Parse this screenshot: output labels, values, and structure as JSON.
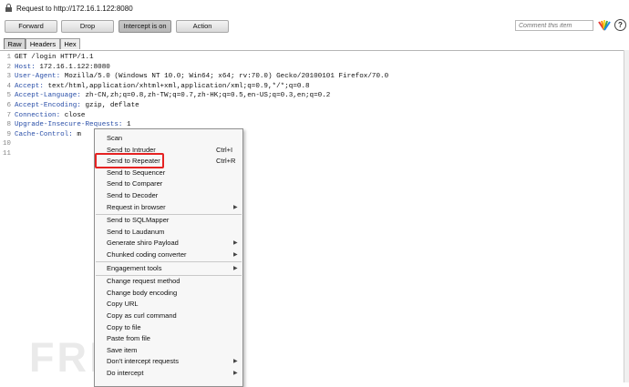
{
  "request_title": "Request to http://172.16.1.122:8080",
  "toolbar": {
    "forward": "Forward",
    "drop": "Drop",
    "intercept": "Intercept is on",
    "action": "Action",
    "comment_placeholder": "Comment this item"
  },
  "tabs": [
    "Raw",
    "Headers",
    "Hex"
  ],
  "lines": [
    {
      "n": "1",
      "k": "",
      "v": "GET /login HTTP/1.1"
    },
    {
      "n": "2",
      "k": "Host:",
      "v": " 172.16.1.122:8080"
    },
    {
      "n": "3",
      "k": "User-Agent:",
      "v": " Mozilla/5.0 (Windows NT 10.0; Win64; x64; rv:70.0) Gecko/20100101 Firefox/70.0"
    },
    {
      "n": "4",
      "k": "Accept:",
      "v": " text/html,application/xhtml+xml,application/xml;q=0.9,*/*;q=0.8"
    },
    {
      "n": "5",
      "k": "Accept-Language:",
      "v": " zh-CN,zh;q=0.8,zh-TW;q=0.7,zh-HK;q=0.5,en-US;q=0.3,en;q=0.2"
    },
    {
      "n": "6",
      "k": "Accept-Encoding:",
      "v": " gzip, deflate"
    },
    {
      "n": "7",
      "k": "Connection:",
      "v": " close"
    },
    {
      "n": "8",
      "k": "Upgrade-Insecure-Requests:",
      "v": " 1"
    },
    {
      "n": "9",
      "k": "Cache-Control:",
      "v": " m"
    },
    {
      "n": "10",
      "k": "",
      "v": ""
    },
    {
      "n": "11",
      "k": "",
      "v": ""
    }
  ],
  "context_menu": {
    "items": [
      {
        "label": "Scan",
        "shortcut": "",
        "submenu": false
      },
      {
        "label": "Send to Intruder",
        "shortcut": "Ctrl+I",
        "submenu": false
      },
      {
        "label": "Send to Repeater",
        "shortcut": "Ctrl+R",
        "submenu": false
      },
      {
        "label": "Send to Sequencer",
        "shortcut": "",
        "submenu": false
      },
      {
        "label": "Send to Comparer",
        "shortcut": "",
        "submenu": false
      },
      {
        "label": "Send to Decoder",
        "shortcut": "",
        "submenu": false
      },
      {
        "label": "Request in browser",
        "shortcut": "",
        "submenu": true
      },
      {
        "label": "Send to SQLMapper",
        "shortcut": "",
        "submenu": false
      },
      {
        "label": "Send to Laudanum",
        "shortcut": "",
        "submenu": false
      },
      {
        "label": "Generate shiro Payload",
        "shortcut": "",
        "submenu": true
      },
      {
        "label": "Chunked coding converter",
        "shortcut": "",
        "submenu": true
      },
      {
        "label": "Engagement tools",
        "shortcut": "",
        "submenu": true
      },
      {
        "label": "Change request method",
        "shortcut": "",
        "submenu": false
      },
      {
        "label": "Change body encoding",
        "shortcut": "",
        "submenu": false
      },
      {
        "label": "Copy URL",
        "shortcut": "",
        "submenu": false
      },
      {
        "label": "Copy as curl command",
        "shortcut": "",
        "submenu": false
      },
      {
        "label": "Copy to file",
        "shortcut": "",
        "submenu": false
      },
      {
        "label": "Paste from file",
        "shortcut": "",
        "submenu": false
      },
      {
        "label": "Save item",
        "shortcut": "",
        "submenu": false
      },
      {
        "label": "Don't intercept requests",
        "shortcut": "",
        "submenu": true
      },
      {
        "label": "Do intercept",
        "shortcut": "",
        "submenu": true
      }
    ],
    "highlighted": "Send to Repeater"
  },
  "watermark": "FREEBUF",
  "colors": {
    "header_key": "#2a4fa8",
    "highlight_box": "#e52222"
  }
}
